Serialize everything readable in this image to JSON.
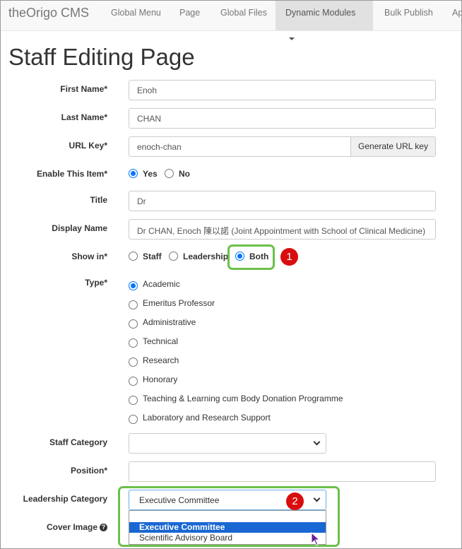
{
  "nav": {
    "brand": "theOrigo CMS",
    "items": [
      "Global Menu",
      "Page",
      "Global Files",
      "Dynamic Modules",
      "Bulk Publish",
      "Ap"
    ]
  },
  "page_title": "Staff Editing Page",
  "form": {
    "first_name": {
      "label": "First Name*",
      "value": "Enoh"
    },
    "last_name": {
      "label": "Last Name*",
      "value": "CHAN"
    },
    "url_key": {
      "label": "URL Key*",
      "value": "enoch-chan",
      "button": "Generate URL key"
    },
    "enable": {
      "label": "Enable This Item*",
      "yes": "Yes",
      "no": "No",
      "selected": "Yes"
    },
    "title": {
      "label": "Title",
      "value": "Dr"
    },
    "display_name": {
      "label": "Display Name",
      "value": "Dr CHAN, Enoch 陳以諾 (Joint Appointment with School of Clinical Medicine)"
    },
    "show_in": {
      "label": "Show in*",
      "options": [
        "Staff",
        "Leadership",
        "Both"
      ],
      "selected": "Both"
    },
    "type": {
      "label": "Type*",
      "options": [
        "Academic",
        "Emeritus Professor",
        "Administrative",
        "Technical",
        "Research",
        "Honorary",
        "Teaching & Learning cum Body Donation Programme",
        "Laboratory and Research Support"
      ],
      "selected": "Academic"
    },
    "staff_category": {
      "label": "Staff Category",
      "value": ""
    },
    "position": {
      "label": "Position*",
      "value": ""
    },
    "leadership_category": {
      "label": "Leadership Category",
      "value": "Executive Committee",
      "options": [
        "",
        "Executive Committee",
        "Scientific Advisory Board"
      ],
      "highlighted": "Executive Committee"
    },
    "cover_image": {
      "label": "Cover Image"
    }
  },
  "annotations": [
    "1",
    "2"
  ],
  "colors": {
    "accent": "#0075ff",
    "highlight_box": "#6cc04a",
    "badge": "#d90d0d",
    "option_selected": "#1967d2"
  }
}
